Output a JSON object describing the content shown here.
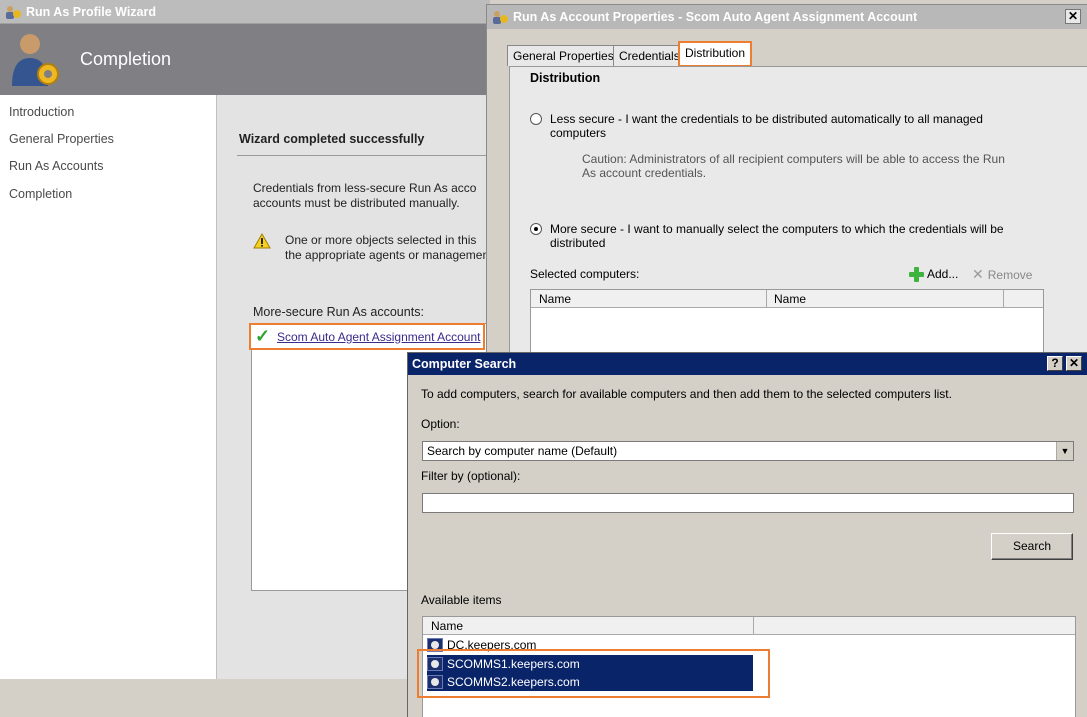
{
  "wizard": {
    "title": "Run As Profile Wizard",
    "page_title": "Completion",
    "nav": [
      "Introduction",
      "General Properties",
      "Run As Accounts",
      "Completion"
    ],
    "heading": "Wizard completed successfully",
    "message_line1": "Credentials from less-secure Run As acco",
    "message_line2": "accounts must be distributed manually.",
    "warning_line1": "One or more objects selected in this",
    "warning_line2": "the appropriate agents or managemen",
    "secure_accounts_label": "More-secure Run As accounts:",
    "account_link": "Scom Auto Agent Assignment Account"
  },
  "properties": {
    "title": "Run As Account Properties - Scom Auto Agent Assignment Account",
    "tabs": [
      "General Properties",
      "Credentials",
      "Distribution"
    ],
    "section": "Distribution",
    "less_secure_line1": "Less secure - I want the credentials to be distributed automatically to all managed",
    "less_secure_line2": "computers",
    "caution_line1": "Caution: Administrators of all recipient computers will be able to access the Run",
    "caution_line2": "As account credentials.",
    "more_secure_line1": "More secure - I want to manually select the computers to which the credentials will be",
    "more_secure_line2": "distributed",
    "selected_label": "Selected computers:",
    "add_label": "Add...",
    "remove_label": "Remove",
    "columns": [
      "Name",
      "Name"
    ]
  },
  "search": {
    "title": "Computer Search",
    "instructions": "To add computers, search for available computers and then add them to the selected computers list.",
    "option_label": "Option:",
    "option_value": "Search by computer name (Default)",
    "filter_label": "Filter by (optional):",
    "filter_value": "",
    "search_button": "Search",
    "available_label": "Available items",
    "column_name": "Name",
    "items": [
      "DC.keepers.com",
      "SCOMMS1.keepers.com",
      "SCOMMS2.keepers.com"
    ]
  },
  "colors": {
    "highlight": "#ed7d31",
    "selection": "#0a246a"
  }
}
